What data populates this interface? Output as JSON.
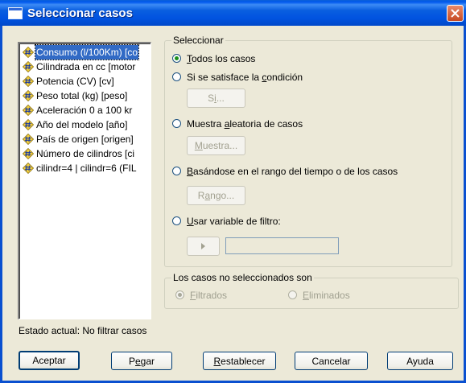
{
  "window": {
    "title": "Seleccionar casos"
  },
  "variables": [
    {
      "label": "Consumo (l/100Km) [co",
      "selected": true
    },
    {
      "label": "Cilindrada en cc [motor"
    },
    {
      "label": "Potencia (CV) [cv]"
    },
    {
      "label": "Peso total (kg) [peso]"
    },
    {
      "label": "Aceleración 0 a 100 kr"
    },
    {
      "label": "Año del modelo [año]"
    },
    {
      "label": "País de origen [origen]"
    },
    {
      "label": "Número de cilindros [ci"
    },
    {
      "label": "cilindr=4 | cilindr=6 (FIL"
    }
  ],
  "select_group": {
    "title": "Seleccionar",
    "options": {
      "all": {
        "mn": "T",
        "rest": "odos los casos"
      },
      "if": {
        "pre": "Si se satisface la ",
        "mn": "c",
        "rest": "ondición"
      },
      "random": {
        "pre": "Muestra ",
        "mn": "a",
        "rest": "leatoria de casos"
      },
      "range": {
        "mn": "B",
        "rest": "asándose en el rango del tiempo o de los casos"
      },
      "filter": {
        "mn": "U",
        "rest": "sar variable de filtro:"
      }
    },
    "buttons": {
      "si": {
        "pre": "S",
        "mn": "i",
        "rest": "..."
      },
      "muestra": {
        "mn": "M",
        "rest": "uestra..."
      },
      "rango": {
        "pre": "R",
        "mn": "a",
        "rest": "ngo..."
      }
    }
  },
  "unselected_group": {
    "title": "Los casos no seleccionados son",
    "filtrados": {
      "mn": "F",
      "rest": "iltrados"
    },
    "eliminados": {
      "mn": "E",
      "rest": "liminados"
    }
  },
  "status": "Estado actual: No filtrar casos",
  "bottom_buttons": {
    "aceptar": "Aceptar",
    "pegar": {
      "pre": "P",
      "mn": "e",
      "rest": "gar"
    },
    "restablecer": {
      "mn": "R",
      "rest": "establecer"
    },
    "cancelar": "Cancelar",
    "ayuda": "Ayuda"
  },
  "colors": {
    "titlebar": "#0058ee",
    "selection": "#316ac5",
    "dialog_bg": "#ece9d8",
    "radio_dot": "#1a8f1a"
  }
}
